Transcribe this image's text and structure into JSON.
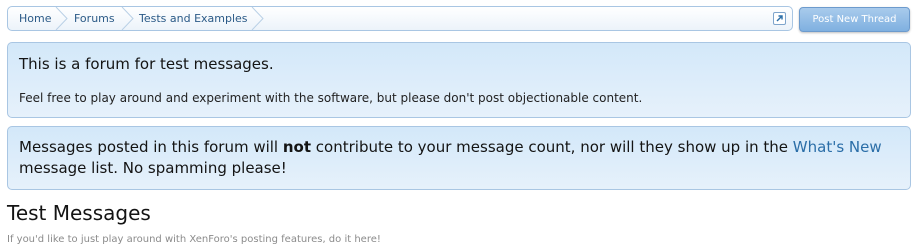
{
  "breadcrumb": {
    "items": [
      "Home",
      "Forums",
      "Tests and Examples"
    ]
  },
  "actions": {
    "post_new_thread": "Post New Thread"
  },
  "notice1": {
    "title": "This is a forum for test messages.",
    "body": "Feel free to play around and experiment with the software, but please don't post objectionable content."
  },
  "notice2": {
    "part1": "Messages posted in this forum will ",
    "emphasis": "not",
    "part2": " contribute to your message count, nor will they show up in the ",
    "link": "What's New",
    "part3": " message list. No spamming please!"
  },
  "forum": {
    "title": "Test Messages",
    "description": "If you'd like to just play around with XenForo's posting features, do it here!"
  },
  "colors": {
    "accent": "#2b6ea8",
    "notice_bg": "#d3e8f9",
    "border": "#a9c6e3",
    "button": "#7fb0e0"
  }
}
